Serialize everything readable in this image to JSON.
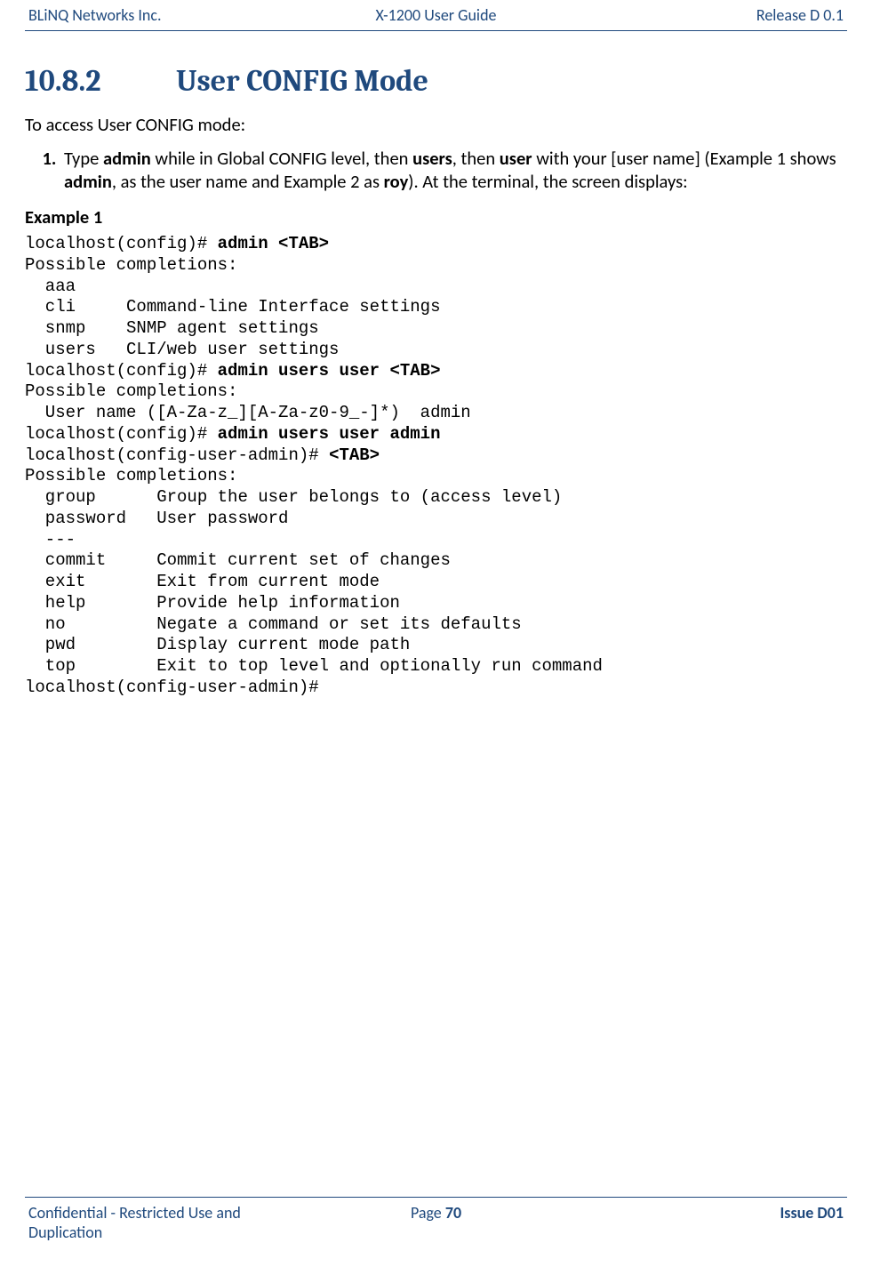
{
  "header": {
    "left": "BLiNQ Networks Inc.",
    "center": "X-1200 User Guide",
    "right": "Release D 0.1"
  },
  "footer": {
    "left": "Confidential - Restricted Use and Duplication",
    "page_label": "Page ",
    "page_number": "70",
    "right": "Issue D01"
  },
  "section": {
    "number": "10.8.2",
    "title": "User CONFIG Mode"
  },
  "intro": "To access User CONFIG mode:",
  "step1": {
    "t0": "Type ",
    "b0": "admin",
    "t1": " while in Global CONFIG level, then ",
    "b1": "users",
    "t2": ", then ",
    "b2": "user",
    "t3": " with your [user name] (Example 1 shows ",
    "b3": "admin",
    "t4": ", as the user name and Example 2 as ",
    "b4": "roy",
    "t5": "). At the terminal, the screen displays:"
  },
  "example1_label": "Example 1",
  "code": {
    "l01a": "localhost(config)# ",
    "l01b": "admin <TAB>",
    "l02": "Possible completions:",
    "l03": "  aaa",
    "l04": "  cli     Command-line Interface settings",
    "l05": "  snmp    SNMP agent settings",
    "l06": "  users   CLI/web user settings",
    "l07a": "localhost(config)# ",
    "l07b": "admin users user <TAB>",
    "l08": "Possible completions:",
    "l09": "  User name ([A-Za-z_][A-Za-z0-9_-]*)  admin",
    "l10a": "localhost(config)# ",
    "l10b": "admin users user admin",
    "l11a": "localhost(config-user-admin)# ",
    "l11b": "<TAB>",
    "l12": "Possible completions:",
    "l13": "  group      Group the user belongs to (access level)",
    "l14": "  password   User password",
    "l15": "  ---",
    "l16": "  commit     Commit current set of changes",
    "l17": "  exit       Exit from current mode",
    "l18": "  help       Provide help information",
    "l19": "  no         Negate a command or set its defaults",
    "l20": "  pwd        Display current mode path",
    "l21": "  top        Exit to top level and optionally run command",
    "l22": "localhost(config-user-admin)#"
  }
}
